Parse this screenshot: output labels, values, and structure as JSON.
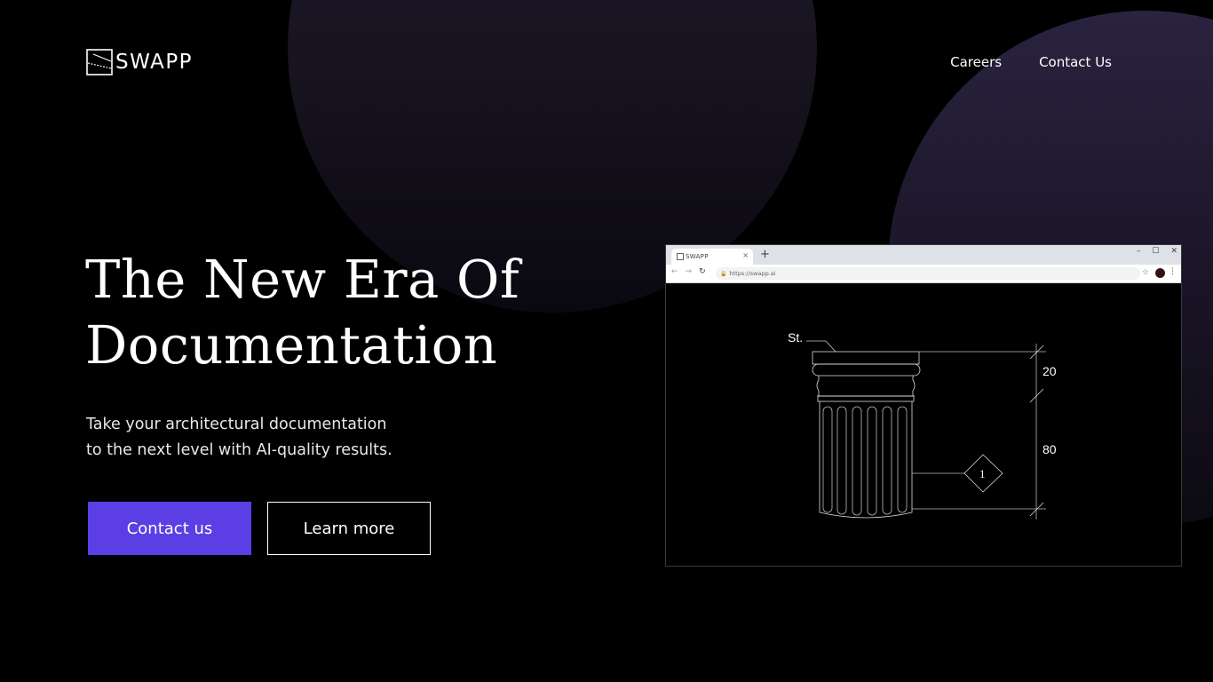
{
  "header": {
    "logo_text": "SWAPP",
    "nav": [
      {
        "label": "Careers"
      },
      {
        "label": "Contact Us"
      }
    ]
  },
  "hero": {
    "title_line1": "The New Era Of",
    "title_line2": "Documentation",
    "subtitle_line1": "Take your architectural documentation",
    "subtitle_line2": "to the next level with AI-quality results.",
    "primary_button": "Contact us",
    "secondary_button": "Learn more"
  },
  "browser": {
    "tab_title": "SWAPP",
    "tab_close": "×",
    "new_tab": "+",
    "window_controls": [
      "–",
      "☐",
      "✕"
    ],
    "url": "https://swapp.ai",
    "drawing": {
      "label": "St.",
      "dim_top": "20",
      "dim_bottom": "80",
      "tag": "1"
    }
  },
  "colors": {
    "accent": "#5b3fe4",
    "background": "#000000",
    "orb": "#221d34"
  }
}
